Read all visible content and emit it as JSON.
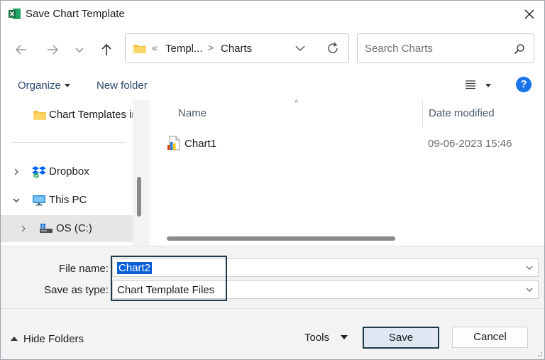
{
  "window": {
    "title": "Save Chart Template",
    "app_icon": "excel-icon",
    "close_icon": "close-icon"
  },
  "nav": {
    "back_icon": "arrow-left-icon",
    "forward_icon": "arrow-right-icon",
    "recent_icon": "chevron-down-icon",
    "up_icon": "arrow-up-icon",
    "address": {
      "overflow": "«",
      "crumbs": [
        "Templ...",
        "Charts"
      ],
      "separator": ">"
    },
    "refresh_icon": "refresh-icon",
    "search_placeholder": "Search Charts"
  },
  "commands": {
    "organize": "Organize",
    "new_folder": "New folder",
    "view_icon": "list-view-icon",
    "help": "?"
  },
  "navpane": {
    "items": [
      {
        "label": "Chart Templates in",
        "icon": "folder-icon",
        "expandable": false,
        "selected": false
      },
      {
        "label": "Dropbox",
        "icon": "dropbox-icon",
        "expandable": true,
        "expanded": false,
        "selected": false
      },
      {
        "label": "This PC",
        "icon": "monitor-icon",
        "expandable": true,
        "expanded": true,
        "selected": false
      },
      {
        "label": "OS (C:)",
        "icon": "drive-icon",
        "expandable": true,
        "expanded": false,
        "selected": true
      }
    ]
  },
  "filelist": {
    "columns": [
      "Name",
      "Date modified"
    ],
    "files": [
      {
        "name": "Chart1",
        "date_modified": "09-06-2023 15:46",
        "icon": "chart-file-icon"
      }
    ]
  },
  "form": {
    "file_name_label": "File name:",
    "file_name_value": "Chart2",
    "save_type_label": "Save as type:",
    "save_type_value": "Chart Template Files"
  },
  "footer": {
    "hide_folders": "Hide Folders",
    "tools": "Tools",
    "save": "Save",
    "cancel": "Cancel"
  },
  "colors": {
    "accent": "#0a5fd8",
    "help_blue": "#1a73e8",
    "highlight_border": "#1d3b47",
    "excel_green": "#1d6f42"
  }
}
